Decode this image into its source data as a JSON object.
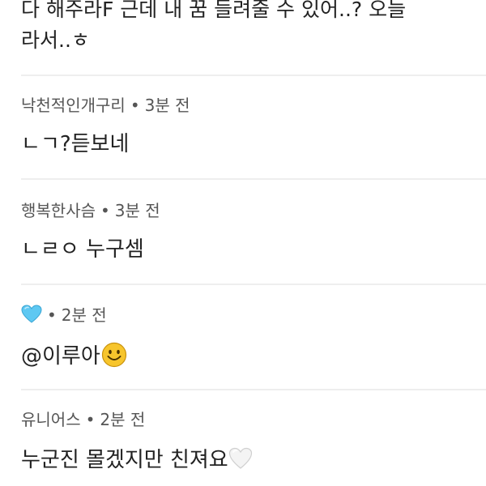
{
  "top_comment": {
    "line1": "다 해주라F 근데 내 꿈 들려줄 수 있어..? 오늘",
    "line2": "라서..ㅎ"
  },
  "comments": [
    {
      "author": "낙천적인개구리",
      "separator": "•",
      "time": "3분 전",
      "text": "ㄴㄱ?듣보네"
    },
    {
      "author": "행복한사슴",
      "separator": "•",
      "time": "3분 전",
      "text": "ㄴㄹㅇ 누구셈"
    },
    {
      "author_icon": "light-blue-heart-icon",
      "separator": "•",
      "time": "2분 전",
      "text": "@이루아",
      "text_emoji": "smiley-face-icon"
    },
    {
      "author": "유니어스",
      "separator": "•",
      "time": "2분 전",
      "text": "누군진 몰겠지만 친져요",
      "text_emoji": "white-heart-icon"
    }
  ],
  "colors": {
    "text_primary": "#222222",
    "text_meta": "#555555",
    "divider": "#eeeeee",
    "heart_blue": "#5ec8f2",
    "smiley_yellow": "#f7c52c"
  }
}
